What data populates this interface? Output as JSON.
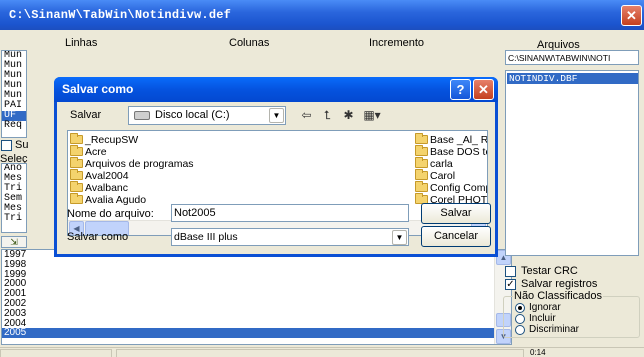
{
  "main_window": {
    "title": "C:\\SinanW\\TabWin\\Notindivw.def",
    "close_label": "✕"
  },
  "background": {
    "col_labels": [
      "Linhas",
      "Colunas",
      "Incremento"
    ],
    "arquivos_label": "Arquivos",
    "arquivos_path": "C:\\SINANW\\TABWIN\\NOTI",
    "arquivos_files": [
      "NOTINDIV.DBF"
    ],
    "list1_items": [
      "Mun",
      "Mun",
      "Mun",
      "Mun",
      "Mun",
      "PAI",
      "UF",
      "Req"
    ],
    "su_label": "Su",
    "selec_label": "Seleç",
    "list2_items": [
      "Ano",
      "Mes",
      "Tri",
      "Sem",
      "Mes",
      "Tri"
    ],
    "years": [
      "1997",
      "1998",
      "1999",
      "2000",
      "2001",
      "2002",
      "2003",
      "2004",
      "2005"
    ],
    "testar_crc": "Testar CRC",
    "salvar_registros": "Salvar registros",
    "nao_classificados": "Não Classificados",
    "radio_options": [
      "Ignorar",
      "Incluir",
      "Discriminar"
    ],
    "status_right": "0:14"
  },
  "dialog": {
    "title": "Salvar como",
    "help_label": "?",
    "close_label": "✕",
    "save_in_label": "Salvar",
    "save_in_value": "Disco local (C:)",
    "folders_left": [
      "_RecupSW",
      "Acre",
      "Arquivos de programas",
      "Aval2004",
      "Avalbanc",
      "Avalia Agudo"
    ],
    "folders_right": [
      "Base _Al_ RI",
      "Base DOS te",
      "carla",
      "Carol",
      "Config Comp",
      "Corel PHOTC"
    ],
    "filename_label": "Nome do arquivo:",
    "filename_value": "Not2005",
    "savetype_label": "Salvar como",
    "savetype_value": "dBase III plus",
    "save_button": "Salvar",
    "cancel_button": "Cancelar"
  },
  "colors": {
    "titlebar": "#1b55cf",
    "selection": "#316ac5",
    "close": "#c3401f"
  }
}
